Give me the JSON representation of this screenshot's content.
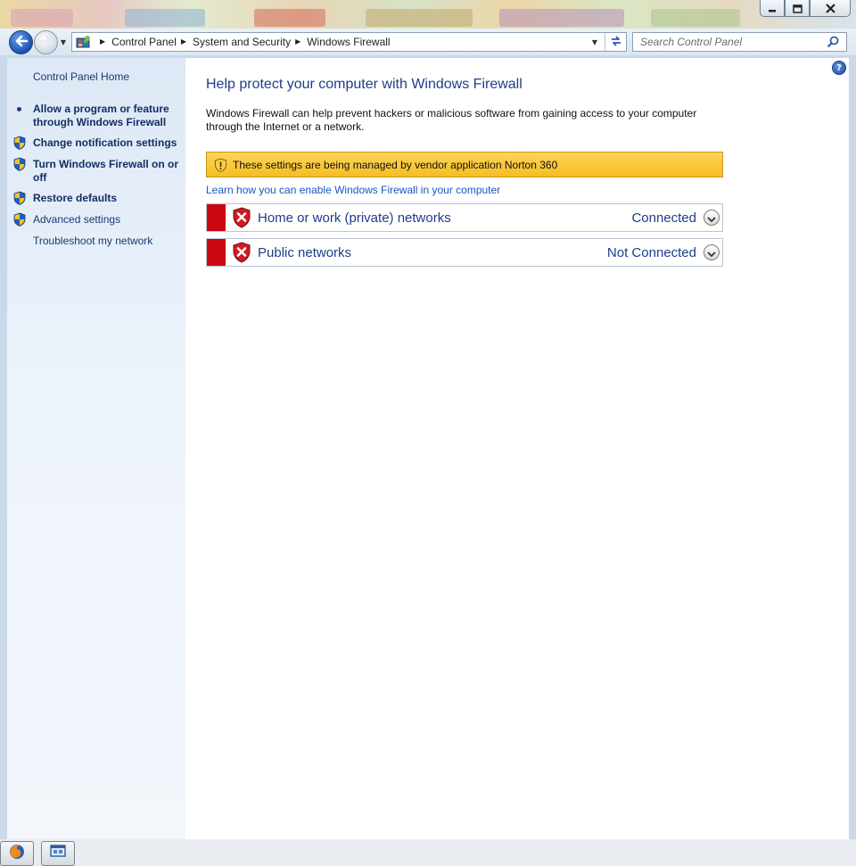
{
  "window": {
    "caption_buttons": [
      "minimize",
      "maximize",
      "close"
    ]
  },
  "nav": {
    "breadcrumbs": [
      "Control Panel",
      "System and Security",
      "Windows Firewall"
    ],
    "search_placeholder": "Search Control Panel"
  },
  "sidebar": {
    "home_label": "Control Panel Home",
    "items": [
      {
        "label_line1": "Allow a program or feature",
        "label_line2": "through Windows Firewall",
        "icon": "bullet-icon",
        "bold": true
      },
      {
        "label": "Change notification settings",
        "icon": "uac-shield-icon",
        "bold": true
      },
      {
        "label_line1": "Turn Windows Firewall on or",
        "label_line2": "off",
        "icon": "uac-shield-icon",
        "bold": true
      },
      {
        "label": "Restore defaults",
        "icon": "uac-shield-icon",
        "bold": true
      },
      {
        "label": "Advanced settings",
        "icon": "uac-shield-icon",
        "bold": false
      },
      {
        "label": "Troubleshoot my network",
        "icon": "none",
        "bold": false
      }
    ]
  },
  "main": {
    "title": "Help protect your computer with Windows Firewall",
    "description_line1": "Windows Firewall can help prevent hackers or malicious software from gaining access to your computer",
    "description_line2": "through the Internet or a network.",
    "warning": "These settings are being managed by vendor application Norton 360",
    "learn_link": "Learn how you can enable Windows Firewall in your computer",
    "networks": [
      {
        "name": "Home or work (private) networks",
        "status": "Connected",
        "icon": "firewall-off-shield-icon"
      },
      {
        "name": "Public networks",
        "status": "Not Connected",
        "icon": "firewall-off-shield-icon"
      }
    ]
  },
  "colors": {
    "title_blue": "#1e3d8a",
    "link_blue": "#1a57c2",
    "warning_yellow": "#f6bd22",
    "status_red": "#cc0712",
    "pane_blue": "#dde8f6"
  }
}
